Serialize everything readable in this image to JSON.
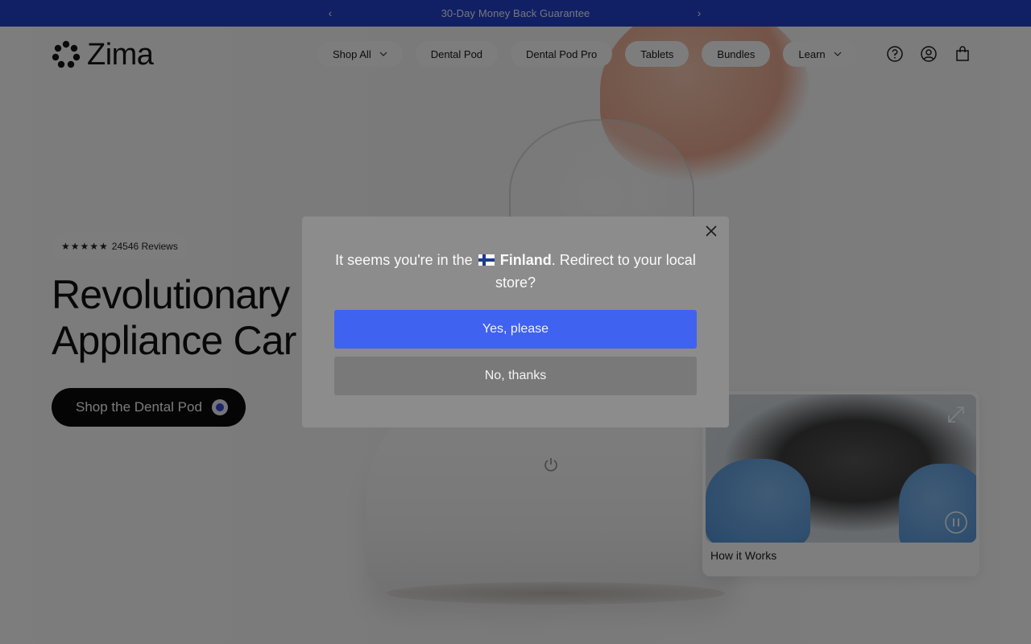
{
  "announcement": {
    "text": "30-Day Money Back Guarantee",
    "prev_icon": "chevron-left-icon",
    "next_icon": "chevron-right-icon"
  },
  "header": {
    "logo_text": "Zima",
    "nav": [
      {
        "label": "Shop All",
        "has_dropdown": true
      },
      {
        "label": "Dental Pod",
        "has_dropdown": false
      },
      {
        "label": "Dental Pod Pro",
        "has_dropdown": false
      },
      {
        "label": "Tablets",
        "has_dropdown": false
      },
      {
        "label": "Bundles",
        "has_dropdown": false
      },
      {
        "label": "Learn",
        "has_dropdown": true
      }
    ],
    "icons": [
      "help-icon",
      "account-icon",
      "cart-icon"
    ]
  },
  "hero": {
    "rating_stars": "★★★★★",
    "rating_text": "24546 Reviews",
    "title_line1": "Revolutionary",
    "title_line2": "Appliance Car",
    "cta_label": "Shop the Dental Pod"
  },
  "video": {
    "caption": "How it Works"
  },
  "modal": {
    "text_before": "It seems you're in the",
    "country": "Finland",
    "text_after": ". Redirect to your local store?",
    "yes_label": "Yes, please",
    "no_label": "No, thanks"
  },
  "colors": {
    "announcement_bg": "#2341c8",
    "yes_button": "#3f62f0",
    "cta_bg": "#0b0b0b"
  }
}
